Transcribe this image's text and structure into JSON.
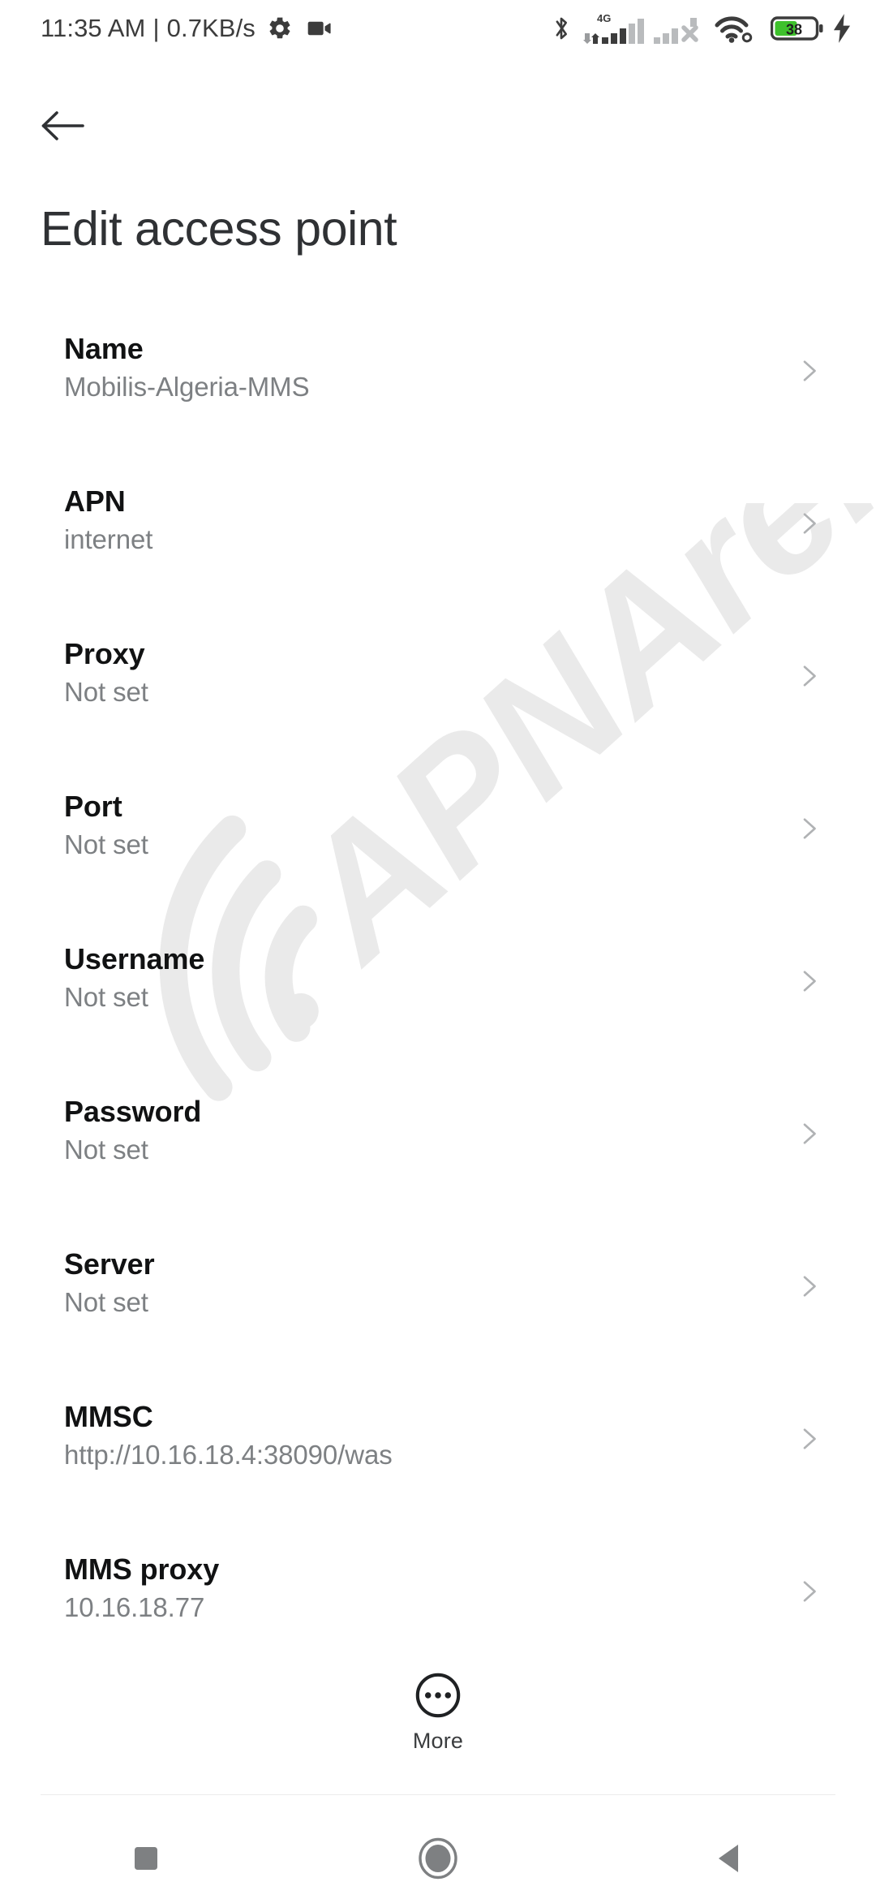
{
  "status_bar": {
    "time": "11:35 AM",
    "separator": "|",
    "network_speed": "0.7KB/s",
    "icons_left": [
      "gear-icon",
      "video-camera-icon"
    ],
    "icons_right": [
      "bluetooth-icon",
      "signal-4g-icon",
      "signal-sim2-no-service-icon",
      "wifi-icon",
      "battery-icon",
      "charging-bolt-icon"
    ],
    "network_type": "4G",
    "battery_percent": "38",
    "battery_color": "#3ec12c"
  },
  "app_bar": {
    "back_icon": "arrow-left-icon",
    "title": "Edit access point"
  },
  "watermark": {
    "text": "APNArena",
    "color": "#eaeaea"
  },
  "settings": {
    "items": [
      {
        "title": "Name",
        "value": "Mobilis-Algeria-MMS"
      },
      {
        "title": "APN",
        "value": "internet"
      },
      {
        "title": "Proxy",
        "value": "Not set"
      },
      {
        "title": "Port",
        "value": "Not set"
      },
      {
        "title": "Username",
        "value": "Not set"
      },
      {
        "title": "Password",
        "value": "Not set"
      },
      {
        "title": "Server",
        "value": "Not set"
      },
      {
        "title": "MMSC",
        "value": "http://10.16.18.4:38090/was"
      },
      {
        "title": "MMS proxy",
        "value": "10.16.18.77"
      }
    ]
  },
  "more_button": {
    "label": "More",
    "icon": "more-horizontal-circle-icon"
  },
  "nav_bar": {
    "recents": "recents-square-icon",
    "home": "home-circle-icon",
    "back": "back-triangle-icon"
  },
  "colors": {
    "title_text": "#2f3134",
    "item_title": "#111213",
    "item_value": "#7d8083",
    "chevron": "#b0b2b4",
    "nav_icon": "#7e8082",
    "divider": "#ececec"
  }
}
